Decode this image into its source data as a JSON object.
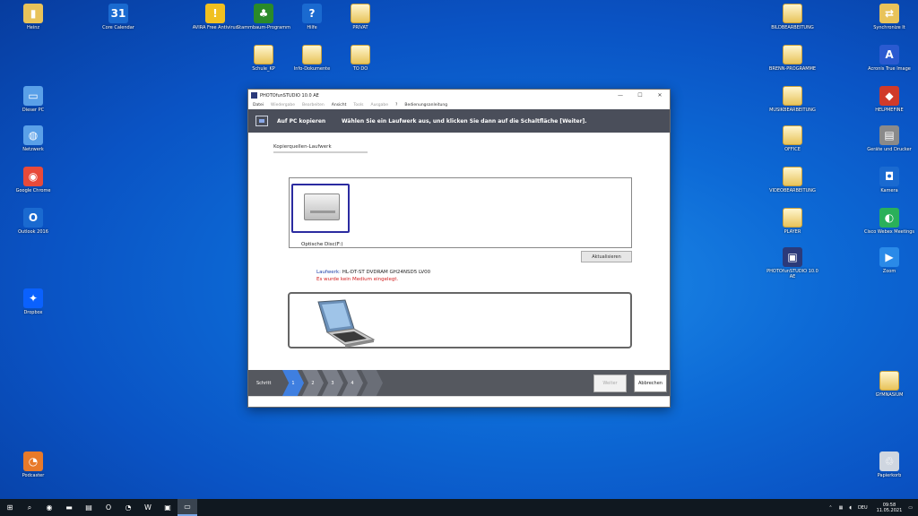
{
  "desktop": {
    "icons_left": [
      {
        "id": "heinz",
        "label": "Heinz",
        "glyph": "▮",
        "color": "#e8c35a"
      },
      {
        "id": "dieser-pc",
        "label": "Dieser PC",
        "glyph": "▭",
        "color": "#5aa0e8"
      },
      {
        "id": "netzwerk",
        "label": "Netzwerk",
        "glyph": "◍",
        "color": "#5aa0e8"
      },
      {
        "id": "chrome",
        "label": "Google Chrome",
        "glyph": "◉",
        "color": "#e84a3a"
      },
      {
        "id": "outlook",
        "label": "Outlook 2016",
        "glyph": "O",
        "color": "#1a6ad0"
      },
      {
        "id": "dropbox",
        "label": "Dropbox",
        "glyph": "✦",
        "color": "#0a61fe"
      },
      {
        "id": "podcast",
        "label": "Podcaster",
        "glyph": "◔",
        "color": "#e87a2a"
      }
    ],
    "icons_top": [
      {
        "id": "core-calendar",
        "label": "Core Calendar",
        "glyph": "31",
        "color": "#1a6ad0"
      },
      {
        "id": "avast",
        "label": "AVIRA Free Antivirus",
        "glyph": "!",
        "color": "#f0c020"
      },
      {
        "id": "tree",
        "label": "Stammbaum-Programm",
        "glyph": "♣",
        "color": "#2a8a2a"
      },
      {
        "id": "help",
        "label": "Hilfe",
        "glyph": "?",
        "color": "#1a6ad0"
      },
      {
        "id": "folder-top",
        "label": "PRIVAT",
        "glyph": "",
        "color": "#e8c35a"
      },
      {
        "id": "doc1",
        "label": "Schule_KP",
        "glyph": "",
        "color": "#e8c35a"
      },
      {
        "id": "doc2",
        "label": "Info-Dokumente",
        "glyph": "",
        "color": "#e8c35a"
      },
      {
        "id": "doc3",
        "label": "TO DO",
        "glyph": "",
        "color": "#e8c35a"
      }
    ],
    "icons_right": [
      {
        "id": "bildbearbeitung",
        "label": "BILDBEARBEITUNG",
        "glyph": "",
        "color": "#e8c35a"
      },
      {
        "id": "brenn",
        "label": "BRENN-PROGRAMME",
        "glyph": "",
        "color": "#e8c35a"
      },
      {
        "id": "musik",
        "label": "MUSIKBEARBEITUNG",
        "glyph": "",
        "color": "#e8c35a"
      },
      {
        "id": "office",
        "label": "OFFICE",
        "glyph": "",
        "color": "#e8c35a"
      },
      {
        "id": "videobearbeitung",
        "label": "VIDEOBEARBEITUNG",
        "glyph": "",
        "color": "#e8c35a"
      },
      {
        "id": "player",
        "label": "PLAYER",
        "glyph": "",
        "color": "#e8c35a"
      },
      {
        "id": "photostudio",
        "label": "PHOTOfunSTUDIO 10.0 AE",
        "glyph": "▣",
        "color": "#2b3a7a"
      },
      {
        "id": "sync",
        "label": "Synchronize It",
        "glyph": "⇄",
        "color": "#e8c35a"
      },
      {
        "id": "acronis",
        "label": "Acronis True Image",
        "glyph": "A",
        "color": "#2a5ad0"
      },
      {
        "id": "helpmefine",
        "label": "HELPMEFINE",
        "glyph": "◆",
        "color": "#d03a2a"
      },
      {
        "id": "geraete",
        "label": "Geräte und Drucker",
        "glyph": "▤",
        "color": "#8a8a8a"
      },
      {
        "id": "kamera",
        "label": "Kamera",
        "glyph": "◘",
        "color": "#1a6ad0"
      },
      {
        "id": "webex",
        "label": "Cisco Webex Meetings",
        "glyph": "◐",
        "color": "#2ab05a"
      },
      {
        "id": "zoom",
        "label": "Zoom",
        "glyph": "▶",
        "color": "#2a8ae8"
      },
      {
        "id": "gymnasium",
        "label": "GYMNASIUM",
        "glyph": "",
        "color": "#e8c35a"
      },
      {
        "id": "papierkorb",
        "label": "Papierkorb",
        "glyph": "♲",
        "color": "#cfd6e0"
      }
    ]
  },
  "window": {
    "title": "PHOTOfunSTUDIO 10.0 AE",
    "controls": {
      "minimize": "—",
      "maximize": "☐",
      "close": "✕"
    },
    "menu": [
      {
        "label": "Datei",
        "enabled": true
      },
      {
        "label": "Wiedergabe",
        "enabled": false
      },
      {
        "label": "Bearbeiten",
        "enabled": false
      },
      {
        "label": "Ansicht",
        "enabled": true
      },
      {
        "label": "Tools",
        "enabled": false
      },
      {
        "label": "Ausgabe",
        "enabled": false
      },
      {
        "label": "?",
        "enabled": true
      },
      {
        "label": "Bedienungsanleitung",
        "enabled": true
      }
    ],
    "banner": {
      "title": "Auf PC kopieren",
      "message": "Wählen Sie ein Laufwerk aus, und klicken Sie dann auf die Schaltfläche [Weiter]."
    },
    "section_label": "Kopierquellen-Laufwerk",
    "drive": {
      "label": "Optische Disc(F:)"
    },
    "refresh_label": "Aktualisieren",
    "drive_info": {
      "key": "Laufwerk:",
      "value": "HL-DT-ST DVDRAM GH24NSD5 LV00",
      "error": "Es wurde kein Medium eingelegt."
    },
    "steps": {
      "label": "Schritt",
      "items": [
        "1",
        "2",
        "3",
        "4"
      ]
    },
    "buttons": {
      "next": "Weiter",
      "cancel": "Abbrechen"
    }
  },
  "taskbar": {
    "items": [
      {
        "id": "start",
        "glyph": "⊞"
      },
      {
        "id": "search",
        "glyph": "⌕"
      },
      {
        "id": "chrome",
        "glyph": "◉"
      },
      {
        "id": "explorer",
        "glyph": "▬"
      },
      {
        "id": "folder",
        "glyph": "▤"
      },
      {
        "id": "outlook",
        "glyph": "O"
      },
      {
        "id": "podcast",
        "glyph": "◔"
      },
      {
        "id": "word",
        "glyph": "W"
      },
      {
        "id": "store",
        "glyph": "▣"
      },
      {
        "id": "photostudio",
        "glyph": "▭"
      }
    ],
    "tray": {
      "language": "DEU",
      "time": "09:58",
      "date": "11.05.2021"
    }
  }
}
